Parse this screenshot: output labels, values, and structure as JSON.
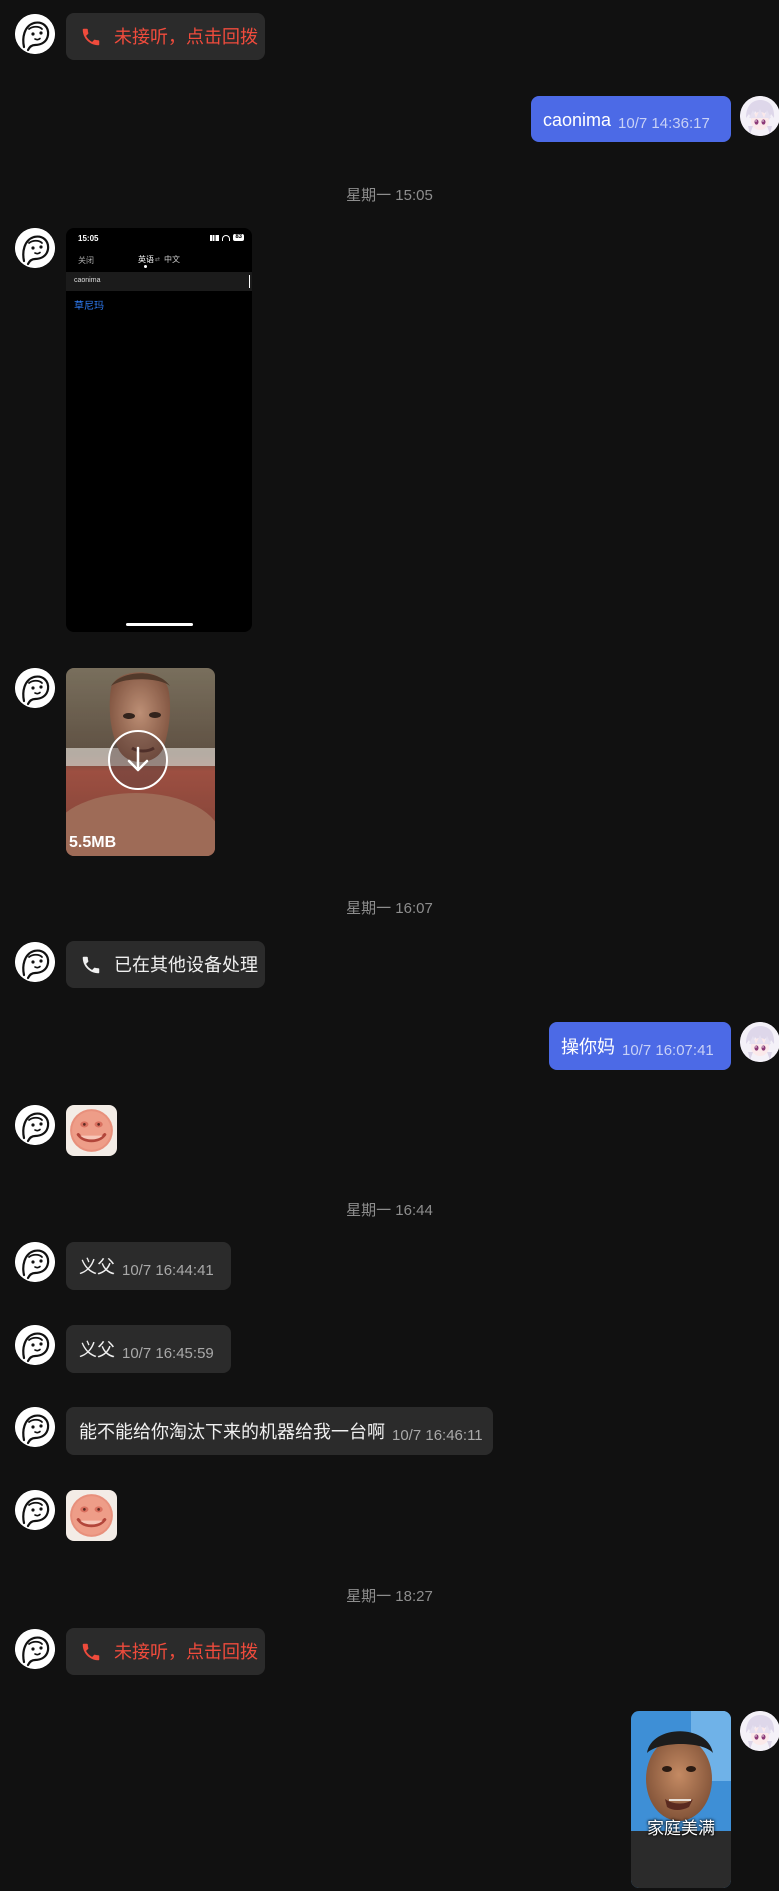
{
  "messages": {
    "m1_call_text": "未接听，点击回拨",
    "m2_text": "caonima",
    "m2_time": "10/7 14:36:17",
    "divider1": "星期一 15:05",
    "screenshot": {
      "status_time": "15:05",
      "battery": "83",
      "tab_left": "关闭",
      "tab_source": "英语",
      "tab_target": "中文",
      "input_text": "caonima",
      "translation": "草尼玛"
    },
    "video_size": "5.5MB",
    "divider2": "星期一 16:07",
    "call_handled_text": "已在其他设备处理",
    "m_out2_text": "操你妈",
    "m_out2_time": "10/7 16:07:41",
    "divider3": "星期一 16:44",
    "m_yifu1_text": "义父",
    "m_yifu1_time": "10/7 16:44:41",
    "m_yifu2_text": "义父",
    "m_yifu2_time": "10/7 16:45:59",
    "m_long_text": "能不能给你淘汰下来的机器给我一台啊",
    "m_long_time": "10/7 16:46:11",
    "divider4": "星期一 18:27",
    "m_call_missed2_text": "未接听，点击回拨",
    "sticker_caption": "家庭美满"
  },
  "colors": {
    "background": "#111111",
    "incoming_bubble": "#2b2b2b",
    "outgoing_bubble": "#4c6ae6",
    "missed_call": "#ef4b3c",
    "link_blue": "#2f7df6"
  },
  "icons": {
    "phone": "phone-icon",
    "download": "download-arrow-icon"
  }
}
